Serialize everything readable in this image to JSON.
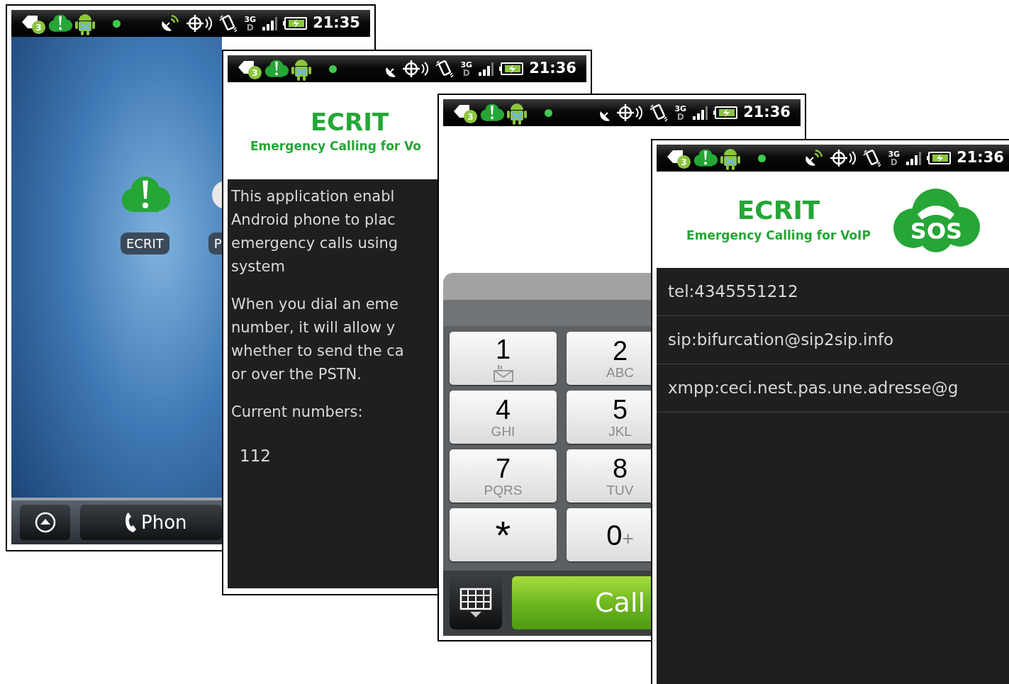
{
  "home_screen": {
    "status_bar": {
      "badge": "3",
      "satellite_active": true,
      "network": "3G",
      "network_sub": "D",
      "time": "21:35"
    },
    "app_labels": [
      "ECRIT",
      "P"
    ],
    "dock": [
      {
        "kind": "launcher"
      },
      {
        "kind": "phone",
        "label": "Phon"
      }
    ]
  },
  "info_screen": {
    "status_bar": {
      "badge": "3",
      "satellite_active": false,
      "network": "3G",
      "network_sub": "D",
      "time": "21:36"
    },
    "title": "ECRIT",
    "subtitle": "Emergency Calling for Vo",
    "paragraphs": [
      {
        "lines": [
          "This application enabl",
          "Android phone to plac",
          "emergency calls using",
          "system"
        ]
      },
      {
        "lines": [
          "When you dial an eme",
          "number, it will allow y",
          "whether to send the ca",
          "or over the PSTN."
        ]
      },
      {
        "lines": [
          "Current numbers:"
        ]
      }
    ],
    "numbers": [
      "112"
    ]
  },
  "dialer_screen": {
    "status_bar": {
      "badge": "3",
      "satellite_active": false,
      "network": "3G",
      "network_sub": "D",
      "time": "21:36"
    },
    "keys": [
      {
        "digit": "1",
        "kind": "voicemail"
      },
      {
        "digit": "2",
        "letters": "ABC",
        "kind": "letters"
      },
      {
        "digit": "4",
        "letters": "GHI",
        "kind": "letters"
      },
      {
        "digit": "5",
        "letters": "JKL",
        "kind": "letters"
      },
      {
        "digit": "7",
        "letters": "PQRS",
        "kind": "letters"
      },
      {
        "digit": "8",
        "letters": "TUV",
        "kind": "letters"
      },
      {
        "digit": "*",
        "kind": "symbol"
      },
      {
        "digit": "0",
        "letters": "+",
        "kind": "plus"
      }
    ],
    "call_button": "Call"
  },
  "list_screen": {
    "status_bar": {
      "badge": "3",
      "satellite_active": true,
      "network": "3G",
      "network_sub": "D",
      "time": "21:36"
    },
    "title": "ECRIT",
    "subtitle": "Emergency Calling for VoIP",
    "logo_text": "SOS",
    "addresses": [
      "tel:4345551212",
      "sip:bifurcation@sip2sip.info",
      "xmpp:ceci.nest.pas.une.adresse@g"
    ]
  }
}
